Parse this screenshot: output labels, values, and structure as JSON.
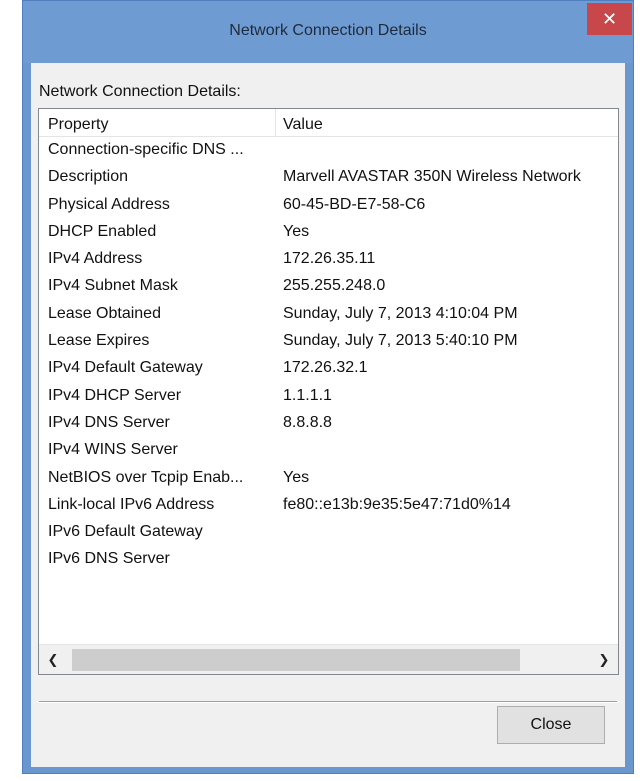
{
  "window": {
    "title": "Network Connection Details",
    "close_glyph": "✕"
  },
  "group_label": "Network Connection Details:",
  "table": {
    "headers": {
      "property": "Property",
      "value": "Value"
    },
    "rows": [
      {
        "property": "Connection-specific DNS ...",
        "value": ""
      },
      {
        "property": "Description",
        "value": "Marvell AVASTAR 350N Wireless Network"
      },
      {
        "property": "Physical Address",
        "value": "60-45-BD-E7-58-C6"
      },
      {
        "property": "DHCP Enabled",
        "value": "Yes"
      },
      {
        "property": "IPv4 Address",
        "value": "172.26.35.11"
      },
      {
        "property": "IPv4 Subnet Mask",
        "value": "255.255.248.0"
      },
      {
        "property": "Lease Obtained",
        "value": "Sunday, July 7, 2013 4:10:04 PM"
      },
      {
        "property": "Lease Expires",
        "value": "Sunday, July 7, 2013 5:40:10 PM"
      },
      {
        "property": "IPv4 Default Gateway",
        "value": "172.26.32.1"
      },
      {
        "property": "IPv4 DHCP Server",
        "value": "1.1.1.1"
      },
      {
        "property": "IPv4 DNS Server",
        "value": "8.8.8.8"
      },
      {
        "property": "IPv4 WINS Server",
        "value": ""
      },
      {
        "property": "NetBIOS over Tcpip Enab...",
        "value": "Yes"
      },
      {
        "property": "Link-local IPv6 Address",
        "value": "fe80::e13b:9e35:5e47:71d0%14"
      },
      {
        "property": "IPv6 Default Gateway",
        "value": ""
      },
      {
        "property": "IPv6 DNS Server",
        "value": ""
      }
    ]
  },
  "scrollbar": {
    "left_glyph": "❮",
    "right_glyph": "❯"
  },
  "close_button_label": "Close",
  "colors": {
    "titlebar": "#6f9bd3",
    "close_red": "#c8474a",
    "client": "#f0f0f0"
  }
}
